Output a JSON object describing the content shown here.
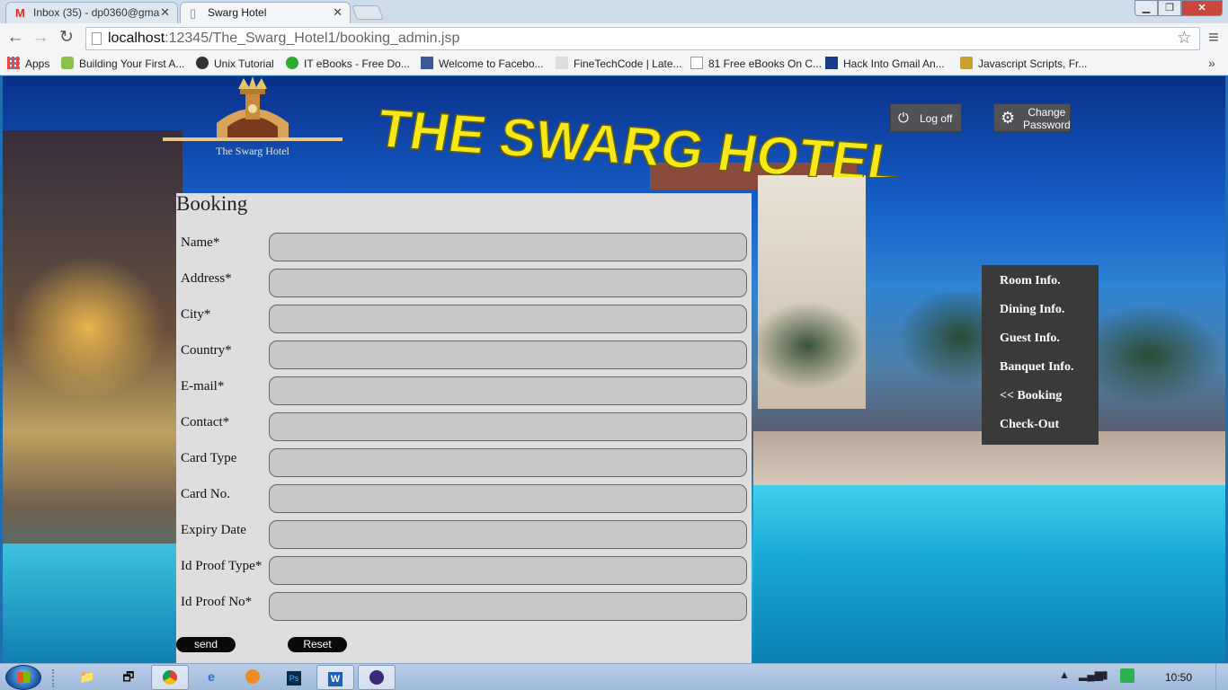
{
  "browser": {
    "tabs": [
      {
        "title": "Inbox (35) - dp0360@gma",
        "icon": "gmail-icon",
        "active": false
      },
      {
        "title": "Swarg Hotel",
        "icon": "page-icon",
        "active": true
      }
    ],
    "address": {
      "host": "localhost",
      "path": ":12345/The_Swarg_Hotel1/booking_admin.jsp"
    },
    "bookmarks": [
      {
        "label": "Apps",
        "icon": "apps-grid-icon"
      },
      {
        "label": "Building Your First A...",
        "icon": "android-icon"
      },
      {
        "label": "Unix Tutorial",
        "icon": "unix-icon"
      },
      {
        "label": "IT eBooks - Free Do...",
        "icon": "green-dot-icon"
      },
      {
        "label": "Welcome to Facebo...",
        "icon": "facebook-icon"
      },
      {
        "label": "FineTechCode | Late...",
        "icon": "ftc-icon"
      },
      {
        "label": "81 Free eBooks On C...",
        "icon": "page-icon"
      },
      {
        "label": "Hack Into Gmail An...",
        "icon": "efy-icon"
      },
      {
        "label": "Javascript Scripts, Fr...",
        "icon": "script-icon"
      }
    ],
    "bookmarks_more": "»"
  },
  "header": {
    "logo_text": "The Swarg Hotel",
    "title": "THE SWARG HOTEL",
    "logoff_label": "Log off",
    "change_password_line1": "Change",
    "change_password_line2": "Password"
  },
  "booking": {
    "heading": "Booking",
    "fields": [
      {
        "label": "Name*",
        "value": ""
      },
      {
        "label": "Address*",
        "value": ""
      },
      {
        "label": "City*",
        "value": ""
      },
      {
        "label": "Country*",
        "value": ""
      },
      {
        "label": "E-mail*",
        "value": ""
      },
      {
        "label": "Contact*",
        "value": ""
      },
      {
        "label": "Card Type",
        "value": ""
      },
      {
        "label": "Card No.",
        "value": ""
      },
      {
        "label": "Expiry Date",
        "value": ""
      },
      {
        "label": "Id Proof Type*",
        "value": ""
      },
      {
        "label": "Id Proof No*",
        "value": ""
      }
    ],
    "send_label": "send",
    "reset_label": "Reset"
  },
  "side_menu": {
    "items": [
      "Room Info.",
      "Dining Info.",
      "Guest Info.",
      "Banquet Info.",
      "<< Booking",
      "Check-Out"
    ]
  },
  "taskbar": {
    "clock": "10:50",
    "apps": [
      "explorer-icon",
      "windows-switch-icon",
      "chrome-icon",
      "ie-icon",
      "media-player-icon",
      "photoshop-icon",
      "word-icon",
      "eclipse-icon"
    ]
  },
  "colors": {
    "title_yellow": "#f7e81a",
    "panel_bg": "#dfdddd",
    "input_bg": "#c9c8c8",
    "menu_bg": "#3a3a3a"
  }
}
